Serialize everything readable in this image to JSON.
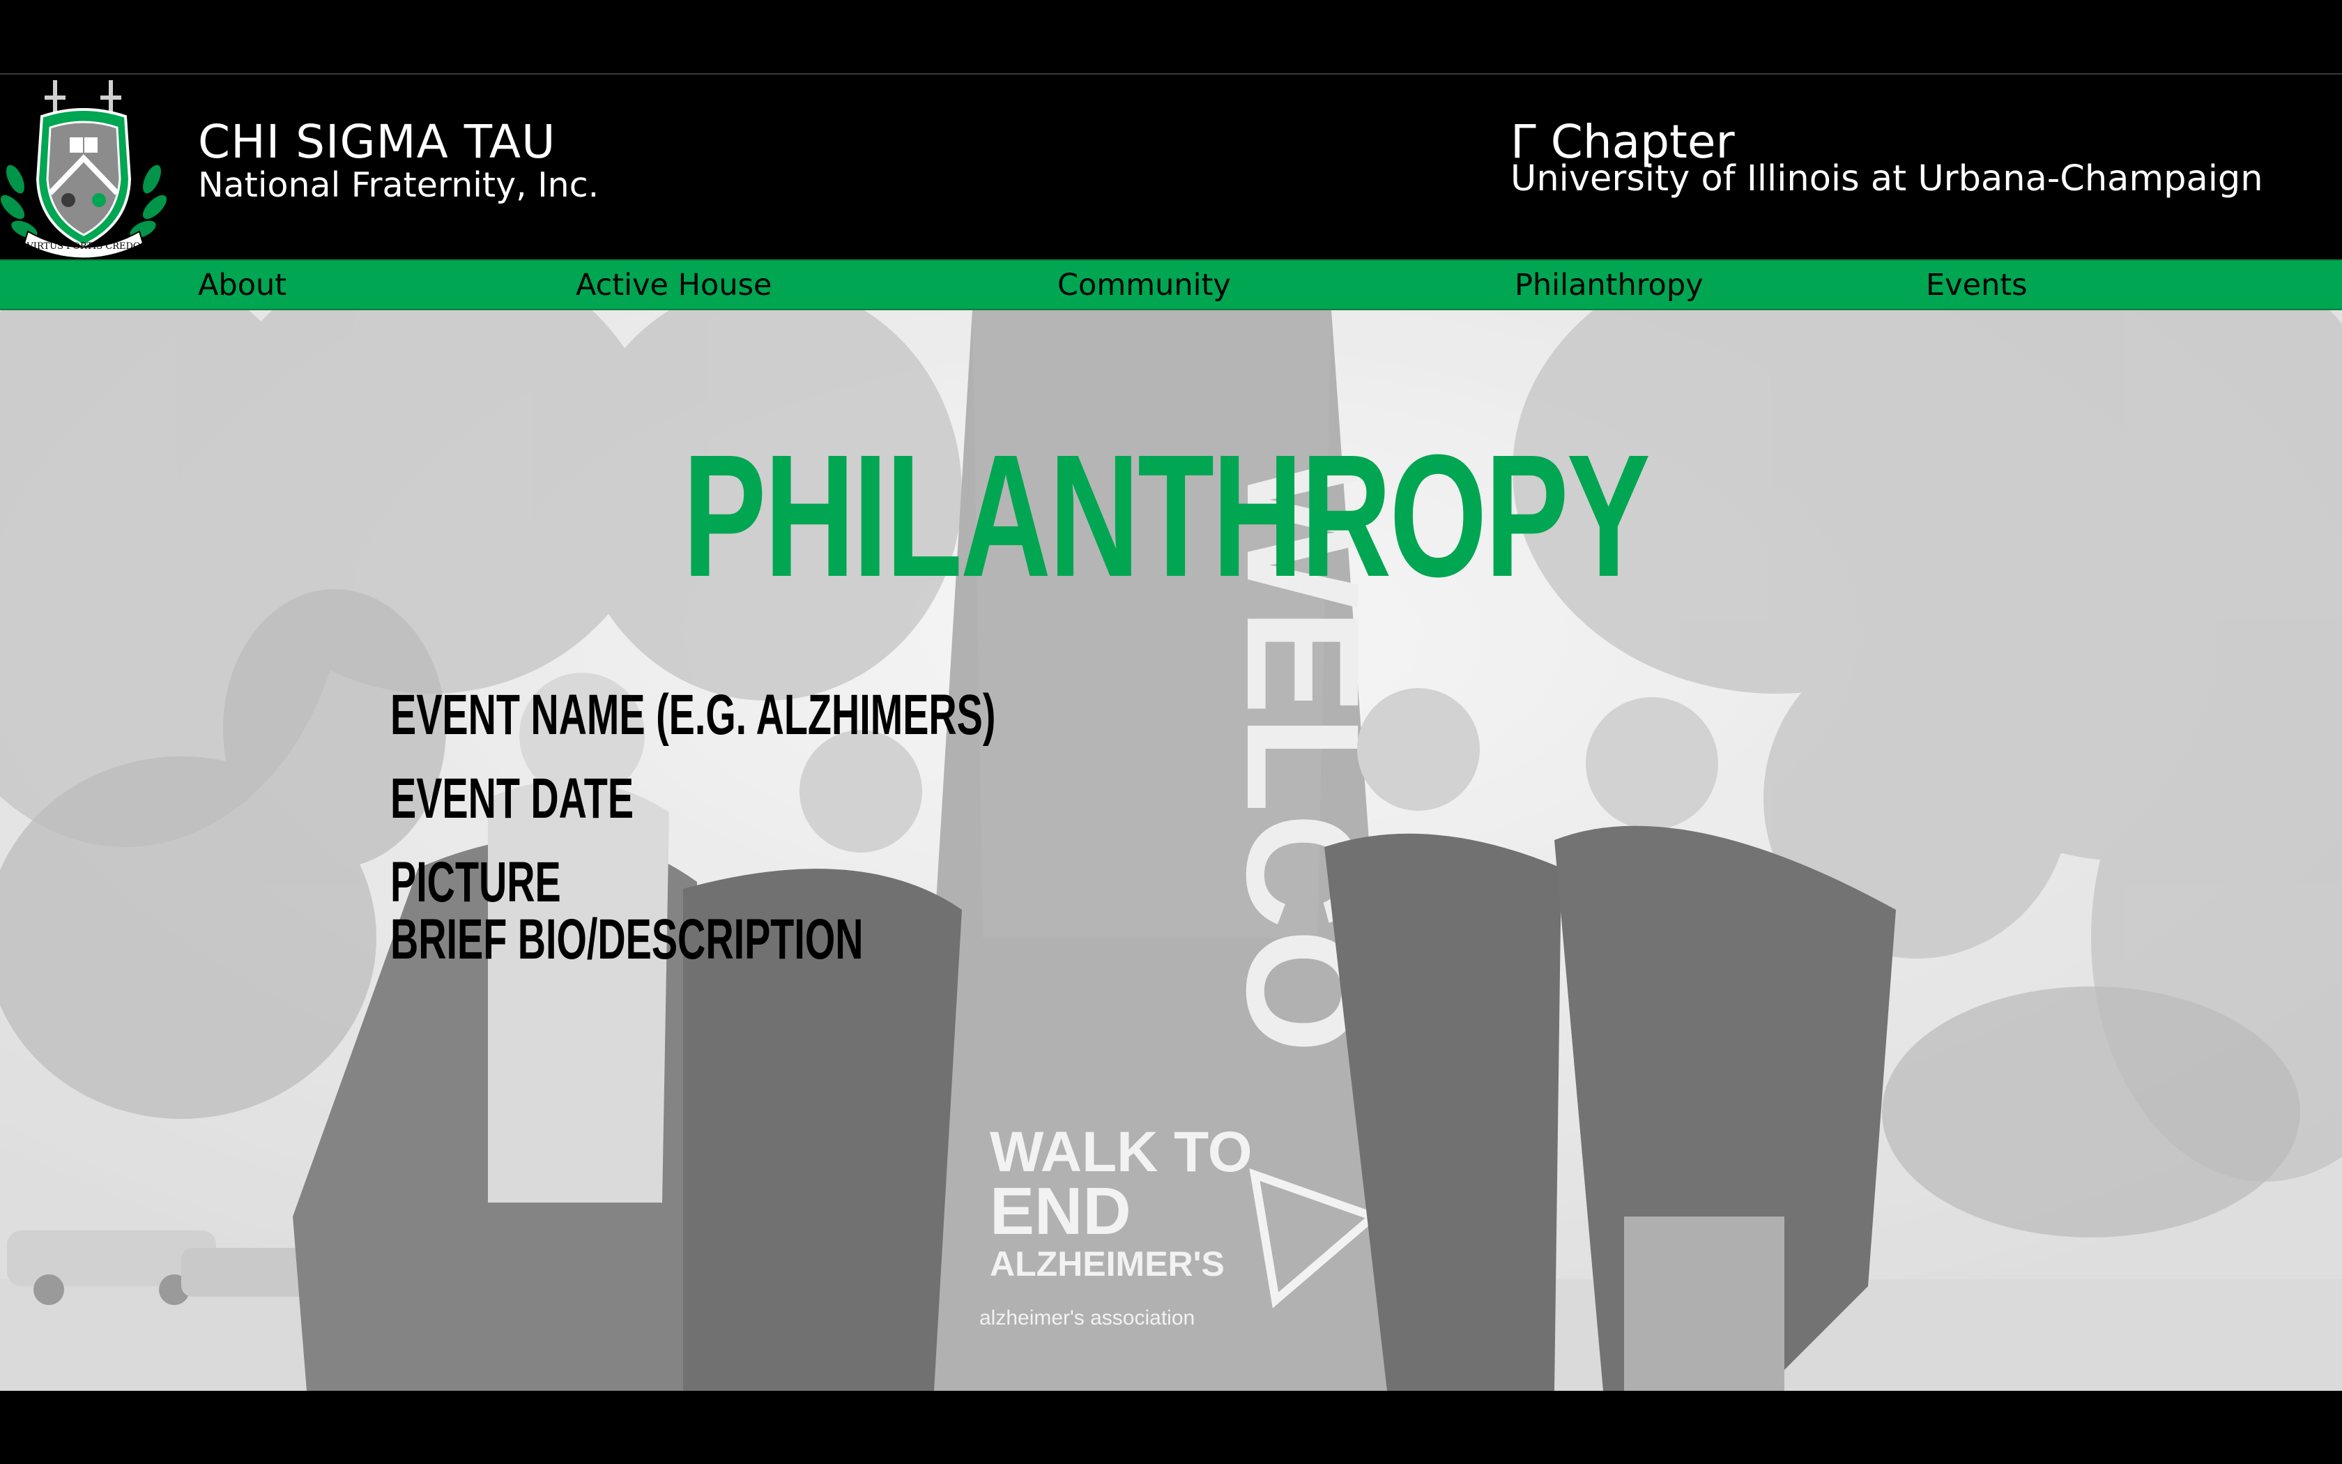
{
  "header": {
    "org_name": "CHI SIGMA TAU",
    "org_subtitle": "National Fraternity, Inc.",
    "chapter_name": "Γ Chapter",
    "university": "University of Illinois at Urbana-Champaign",
    "crest_motto": "VIRTUS FORTIS CREDO"
  },
  "nav": {
    "items": [
      {
        "label": "About"
      },
      {
        "label": "Active House"
      },
      {
        "label": "Community"
      },
      {
        "label": "Philanthropy"
      },
      {
        "label": "Events"
      }
    ]
  },
  "main": {
    "page_title": "PHILANTHROPY",
    "event_name": "EVENT NAME (E.G. ALZHIMERS)",
    "event_date": "EVENT DATE",
    "picture": "PICTURE",
    "description": "BRIEF BIO/DESCRIPTION"
  },
  "banner": {
    "line1": "WALK TO",
    "line2": "END",
    "line3": "ALZHEIMER'S",
    "sponsor": "alzheimer's association",
    "flag_text": "WELCO"
  },
  "colors": {
    "accent_green": "#00a651",
    "header_bg": "#000000",
    "nav_text": "#000000"
  }
}
